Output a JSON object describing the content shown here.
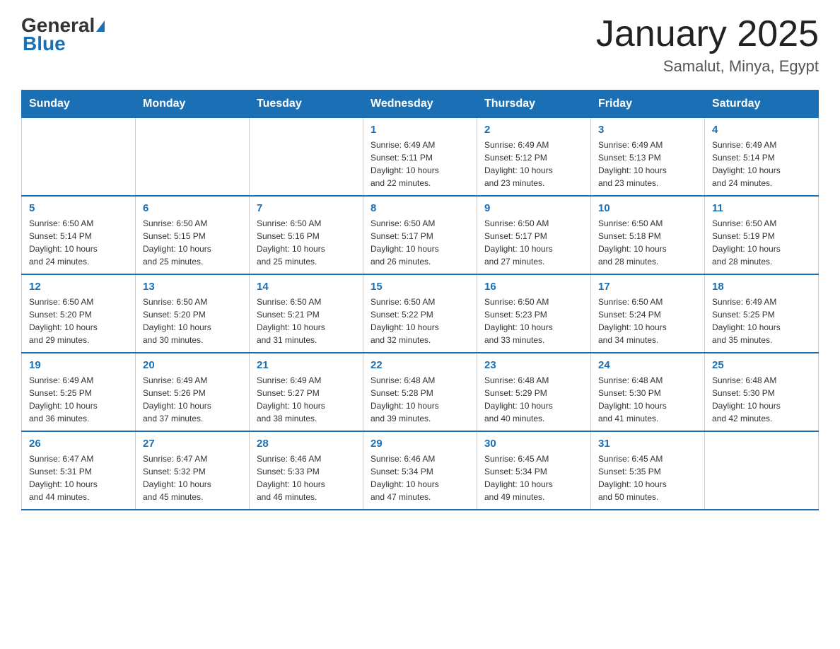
{
  "header": {
    "logo_general": "General",
    "logo_blue": "Blue",
    "title": "January 2025",
    "subtitle": "Samalut, Minya, Egypt"
  },
  "days_of_week": [
    "Sunday",
    "Monday",
    "Tuesday",
    "Wednesday",
    "Thursday",
    "Friday",
    "Saturday"
  ],
  "weeks": [
    [
      {
        "num": "",
        "info": ""
      },
      {
        "num": "",
        "info": ""
      },
      {
        "num": "",
        "info": ""
      },
      {
        "num": "1",
        "info": "Sunrise: 6:49 AM\nSunset: 5:11 PM\nDaylight: 10 hours\nand 22 minutes."
      },
      {
        "num": "2",
        "info": "Sunrise: 6:49 AM\nSunset: 5:12 PM\nDaylight: 10 hours\nand 23 minutes."
      },
      {
        "num": "3",
        "info": "Sunrise: 6:49 AM\nSunset: 5:13 PM\nDaylight: 10 hours\nand 23 minutes."
      },
      {
        "num": "4",
        "info": "Sunrise: 6:49 AM\nSunset: 5:14 PM\nDaylight: 10 hours\nand 24 minutes."
      }
    ],
    [
      {
        "num": "5",
        "info": "Sunrise: 6:50 AM\nSunset: 5:14 PM\nDaylight: 10 hours\nand 24 minutes."
      },
      {
        "num": "6",
        "info": "Sunrise: 6:50 AM\nSunset: 5:15 PM\nDaylight: 10 hours\nand 25 minutes."
      },
      {
        "num": "7",
        "info": "Sunrise: 6:50 AM\nSunset: 5:16 PM\nDaylight: 10 hours\nand 25 minutes."
      },
      {
        "num": "8",
        "info": "Sunrise: 6:50 AM\nSunset: 5:17 PM\nDaylight: 10 hours\nand 26 minutes."
      },
      {
        "num": "9",
        "info": "Sunrise: 6:50 AM\nSunset: 5:17 PM\nDaylight: 10 hours\nand 27 minutes."
      },
      {
        "num": "10",
        "info": "Sunrise: 6:50 AM\nSunset: 5:18 PM\nDaylight: 10 hours\nand 28 minutes."
      },
      {
        "num": "11",
        "info": "Sunrise: 6:50 AM\nSunset: 5:19 PM\nDaylight: 10 hours\nand 28 minutes."
      }
    ],
    [
      {
        "num": "12",
        "info": "Sunrise: 6:50 AM\nSunset: 5:20 PM\nDaylight: 10 hours\nand 29 minutes."
      },
      {
        "num": "13",
        "info": "Sunrise: 6:50 AM\nSunset: 5:20 PM\nDaylight: 10 hours\nand 30 minutes."
      },
      {
        "num": "14",
        "info": "Sunrise: 6:50 AM\nSunset: 5:21 PM\nDaylight: 10 hours\nand 31 minutes."
      },
      {
        "num": "15",
        "info": "Sunrise: 6:50 AM\nSunset: 5:22 PM\nDaylight: 10 hours\nand 32 minutes."
      },
      {
        "num": "16",
        "info": "Sunrise: 6:50 AM\nSunset: 5:23 PM\nDaylight: 10 hours\nand 33 minutes."
      },
      {
        "num": "17",
        "info": "Sunrise: 6:50 AM\nSunset: 5:24 PM\nDaylight: 10 hours\nand 34 minutes."
      },
      {
        "num": "18",
        "info": "Sunrise: 6:49 AM\nSunset: 5:25 PM\nDaylight: 10 hours\nand 35 minutes."
      }
    ],
    [
      {
        "num": "19",
        "info": "Sunrise: 6:49 AM\nSunset: 5:25 PM\nDaylight: 10 hours\nand 36 minutes."
      },
      {
        "num": "20",
        "info": "Sunrise: 6:49 AM\nSunset: 5:26 PM\nDaylight: 10 hours\nand 37 minutes."
      },
      {
        "num": "21",
        "info": "Sunrise: 6:49 AM\nSunset: 5:27 PM\nDaylight: 10 hours\nand 38 minutes."
      },
      {
        "num": "22",
        "info": "Sunrise: 6:48 AM\nSunset: 5:28 PM\nDaylight: 10 hours\nand 39 minutes."
      },
      {
        "num": "23",
        "info": "Sunrise: 6:48 AM\nSunset: 5:29 PM\nDaylight: 10 hours\nand 40 minutes."
      },
      {
        "num": "24",
        "info": "Sunrise: 6:48 AM\nSunset: 5:30 PM\nDaylight: 10 hours\nand 41 minutes."
      },
      {
        "num": "25",
        "info": "Sunrise: 6:48 AM\nSunset: 5:30 PM\nDaylight: 10 hours\nand 42 minutes."
      }
    ],
    [
      {
        "num": "26",
        "info": "Sunrise: 6:47 AM\nSunset: 5:31 PM\nDaylight: 10 hours\nand 44 minutes."
      },
      {
        "num": "27",
        "info": "Sunrise: 6:47 AM\nSunset: 5:32 PM\nDaylight: 10 hours\nand 45 minutes."
      },
      {
        "num": "28",
        "info": "Sunrise: 6:46 AM\nSunset: 5:33 PM\nDaylight: 10 hours\nand 46 minutes."
      },
      {
        "num": "29",
        "info": "Sunrise: 6:46 AM\nSunset: 5:34 PM\nDaylight: 10 hours\nand 47 minutes."
      },
      {
        "num": "30",
        "info": "Sunrise: 6:45 AM\nSunset: 5:34 PM\nDaylight: 10 hours\nand 49 minutes."
      },
      {
        "num": "31",
        "info": "Sunrise: 6:45 AM\nSunset: 5:35 PM\nDaylight: 10 hours\nand 50 minutes."
      },
      {
        "num": "",
        "info": ""
      }
    ]
  ]
}
